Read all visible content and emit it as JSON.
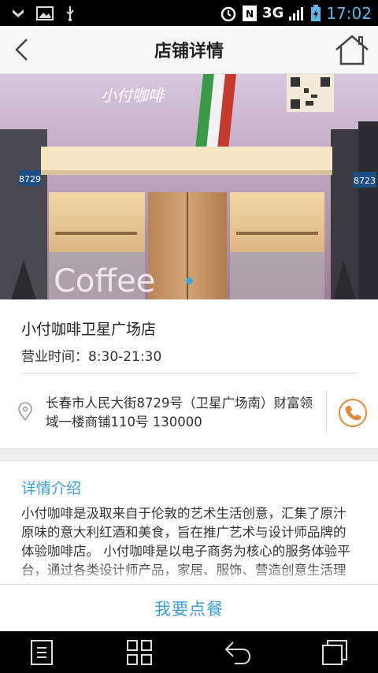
{
  "status_bar": {
    "time": "17:02",
    "network": "3G"
  },
  "header": {
    "title": "店铺详情"
  },
  "hero": {
    "brand_sign": "小付咖啡",
    "window_text": "Coffee",
    "left_number": "8729",
    "right_number": "8723",
    "slide_count": 1,
    "active_slide": 0
  },
  "store": {
    "name": "小付咖啡卫星广场店",
    "hours": "营业时间：8:30-21:30",
    "address": "长春市人民大街8729号（卫星广场南）财富领域一楼商铺110号 130000"
  },
  "detail": {
    "title": "详情介绍",
    "text": "小付咖啡是汲取来自于伦敦的艺术生活创意，汇集了原汁原味的意大利红酒和美食，旨在推广艺术与设计师品牌的体验咖啡店。 小付咖啡是以电子商务为核心的服务体验平台，通过各类设计师产品，家居、服饰、营造创意生活理念，为您提供品味生活"
  },
  "order_button": {
    "label": "我要点餐"
  },
  "colors": {
    "accent": "#3d9fd8",
    "phone_icon": "#e08a3a"
  }
}
